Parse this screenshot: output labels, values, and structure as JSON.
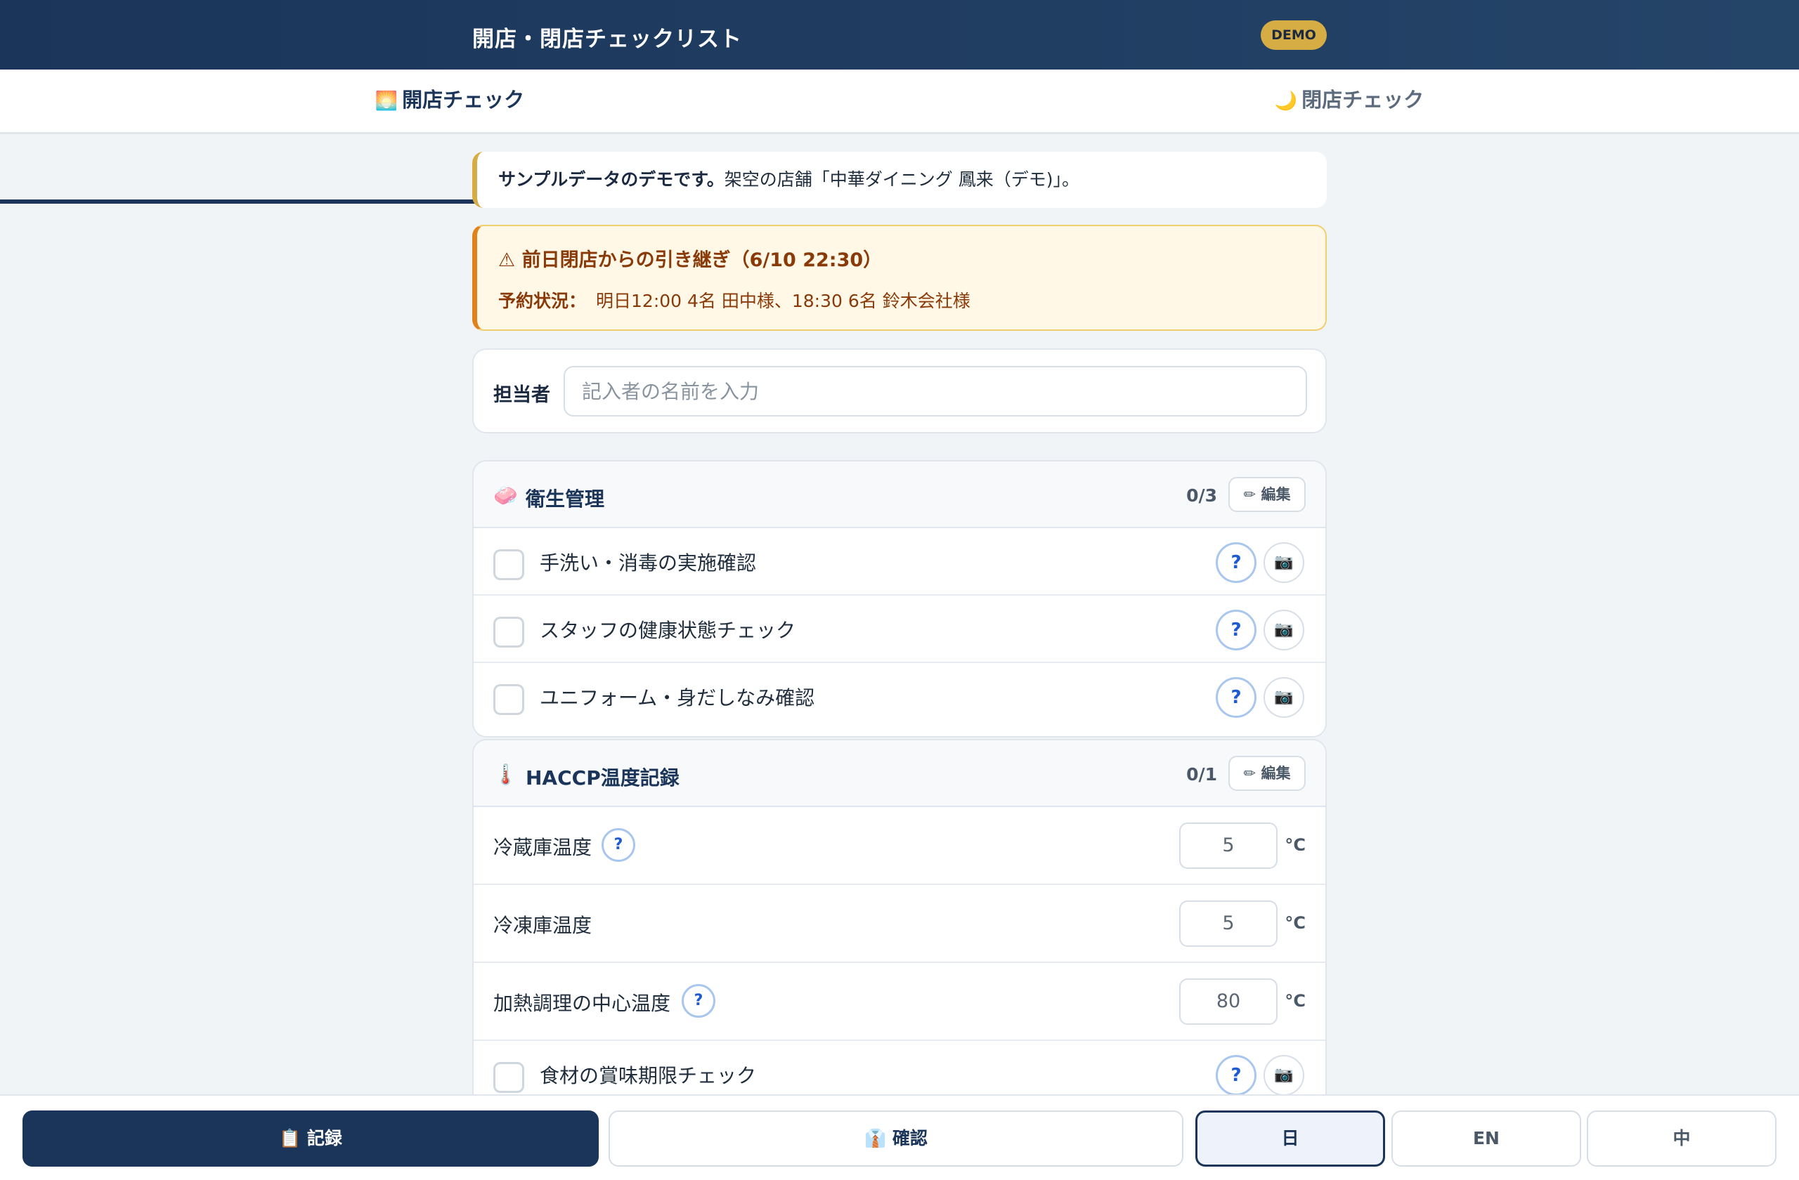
{
  "header": {
    "title": "開店・閉店チェックリスト",
    "badge": "DEMO"
  },
  "tabs": [
    {
      "icon": "🌅",
      "label": "開店チェック",
      "active": true
    },
    {
      "icon": "🌙",
      "label": "閉店チェック",
      "active": false
    }
  ],
  "notice": {
    "bold": "サンプルデータのデモです。",
    "text": "架空の店舗「中華ダイニング 鳳来（デモ)」。"
  },
  "handover": {
    "title": "⚠ 前日閉店からの引き継ぎ（6/10 22:30）",
    "label": "予約状況：",
    "value": "明日12:00 4名 田中様、18:30 6名 鈴木会社様"
  },
  "person": {
    "label": "担当者",
    "placeholder": "記入者の名前を入力"
  },
  "sections": {
    "hygiene": {
      "icon": "🧼",
      "title": "衛生管理",
      "count": "0/3",
      "edit": "✏ 編集",
      "items": [
        {
          "label": "手洗い・消毒の実施確認",
          "help": "?",
          "camera": "📷"
        },
        {
          "label": "スタッフの健康状態チェック",
          "help": "?",
          "camera": "📷"
        },
        {
          "label": "ユニフォーム・身だしなみ確認",
          "help": "?",
          "camera": "📷"
        }
      ]
    },
    "haccp": {
      "icon": "🌡️",
      "title": "HACCP温度記録",
      "count": "0/1",
      "edit": "✏ 編集",
      "temps": [
        {
          "label": "冷蔵庫温度",
          "help": "?",
          "value": "5",
          "unit": "°C"
        },
        {
          "label": "冷凍庫温度",
          "value": "5",
          "unit": "°C"
        },
        {
          "label": "加熱調理の中心温度",
          "help": "?",
          "value": "80",
          "unit": "°C"
        }
      ],
      "items": [
        {
          "label": "食材の賞味期限チェック",
          "help": "?",
          "camera": "📷"
        }
      ]
    }
  },
  "bottom_bar": {
    "record": "📋 記録",
    "confirm": "👔 確認",
    "lang_ja": "日",
    "lang_en": "EN",
    "lang_zh": "中"
  },
  "colors": {
    "primary": "#1b355a",
    "accent": "#d6ad45",
    "warning_border": "#e0821c",
    "help_blue": "#1d5bd6"
  }
}
